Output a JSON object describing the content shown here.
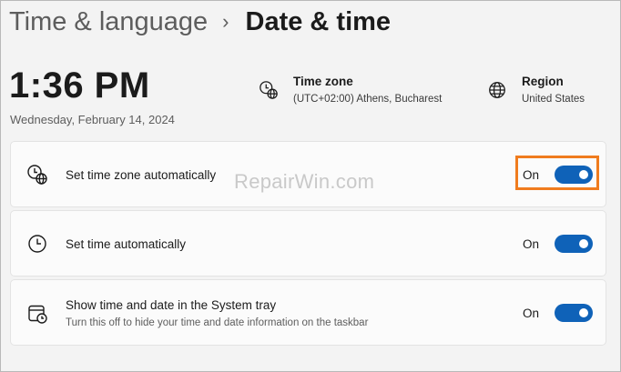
{
  "breadcrumb": {
    "parent": "Time & language",
    "separator": "›",
    "current": "Date & time"
  },
  "clock": {
    "time": "1:36 PM",
    "date": "Wednesday, February 14, 2024"
  },
  "time_zone": {
    "title": "Time zone",
    "value": "(UTC+02:00) Athens, Bucharest",
    "icon": "clock-globe-icon"
  },
  "region": {
    "title": "Region",
    "value": "United States",
    "icon": "globe-icon"
  },
  "settings": [
    {
      "label": "Set time zone automatically",
      "state": "On",
      "icon": "clock-globe-icon",
      "enabled": true
    },
    {
      "label": "Set time automatically",
      "state": "On",
      "icon": "clock-icon",
      "enabled": true
    },
    {
      "label": "Show time and date in the System tray",
      "description": "Turn this off to hide your time and date information on the taskbar",
      "state": "On",
      "icon": "calendar-clock-icon",
      "enabled": true
    }
  ],
  "watermark": "RepairWin.com",
  "colors": {
    "accent": "#0f62b8",
    "highlight": "#f07c1e",
    "background": "#f3f3f3",
    "card": "#fbfbfb"
  }
}
